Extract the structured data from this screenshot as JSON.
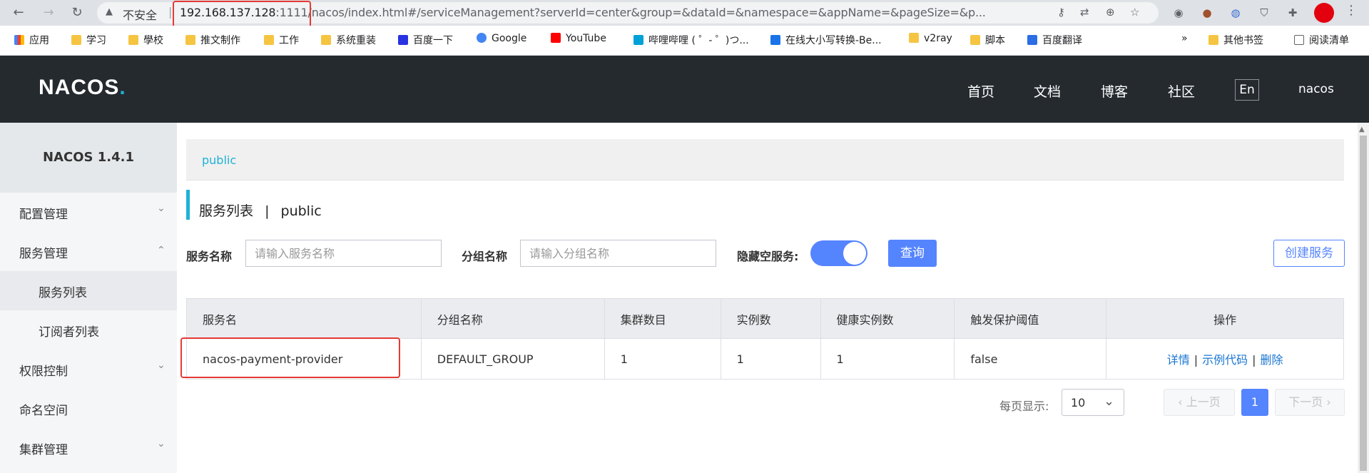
{
  "browser": {
    "insecure_label": "不安全",
    "url_host": "192.168.137.128",
    "url_port": ":1111",
    "url_path": "/nacos/index.html#/serviceManagement?serverId=center&group=&dataId=&namespace=&appName=&pageSize=&p..."
  },
  "bookmarks": [
    {
      "label": "应用",
      "icon": "apps-grid-icon"
    },
    {
      "label": "学习",
      "icon": "folder-icon"
    },
    {
      "label": "學校",
      "icon": "folder-icon"
    },
    {
      "label": "推文制作",
      "icon": "folder-icon"
    },
    {
      "label": "工作",
      "icon": "folder-icon"
    },
    {
      "label": "系统重装",
      "icon": "folder-icon"
    },
    {
      "label": "百度一下",
      "icon": "baidu-icon"
    },
    {
      "label": "Google",
      "icon": "google-icon"
    },
    {
      "label": "YouTube",
      "icon": "youtube-icon"
    },
    {
      "label": "哔哩哔哩 ( ゜- ゜)つ...",
      "icon": "bilibili-icon"
    },
    {
      "label": "在线大小写转换-Be...",
      "icon": "b-icon"
    },
    {
      "label": "v2ray",
      "icon": "folder-icon"
    },
    {
      "label": "脚本",
      "icon": "folder-icon"
    },
    {
      "label": "百度翻译",
      "icon": "translate-icon"
    }
  ],
  "bookmarks_more": "»",
  "bookmarks_other": "其他书签",
  "bookmarks_reading": "阅读清单",
  "nacos": {
    "logo": "NACOS",
    "logo_dot": ".",
    "nav": [
      "首页",
      "文档",
      "博客",
      "社区"
    ],
    "lang": "En",
    "user": "nacos"
  },
  "sidebar": {
    "version": "NACOS 1.4.1",
    "items": [
      {
        "label": "配置管理",
        "chevron": "⌄"
      },
      {
        "label": "服务管理",
        "chevron": "⌃"
      },
      {
        "label": "服务列表"
      },
      {
        "label": "订阅者列表"
      },
      {
        "label": "权限控制",
        "chevron": "⌄"
      },
      {
        "label": "命名空间"
      },
      {
        "label": "集群管理",
        "chevron": "⌄"
      }
    ]
  },
  "main": {
    "namespace_link": "public",
    "title": "服务列表",
    "title_sep": "|",
    "title_ns": "public",
    "filters": {
      "service_name_label": "服务名称",
      "service_name_placeholder": "请输入服务名称",
      "group_name_label": "分组名称",
      "group_name_placeholder": "请输入分组名称",
      "hide_empty_label": "隐藏空服务:",
      "hide_empty_on": true,
      "query_button": "查询",
      "create_button": "创建服务"
    },
    "table": {
      "headers": [
        "服务名",
        "分组名称",
        "集群数目",
        "实例数",
        "健康实例数",
        "触发保护阈值",
        "操作"
      ],
      "rows": [
        {
          "service": "nacos-payment-provider",
          "group": "DEFAULT_GROUP",
          "clusters": "1",
          "instances": "1",
          "healthy": "1",
          "threshold": "false",
          "ops": [
            "详情",
            "示例代码",
            "删除"
          ]
        }
      ]
    },
    "pagination": {
      "per_page_label": "每页显示:",
      "page_size": "10",
      "prev": "上一页",
      "current": "1",
      "next": "下一页"
    }
  },
  "colors": {
    "header_bg": "#252a2f",
    "accent": "#5584ff",
    "link": "#1fb2d6",
    "highlight": "#e53935"
  }
}
